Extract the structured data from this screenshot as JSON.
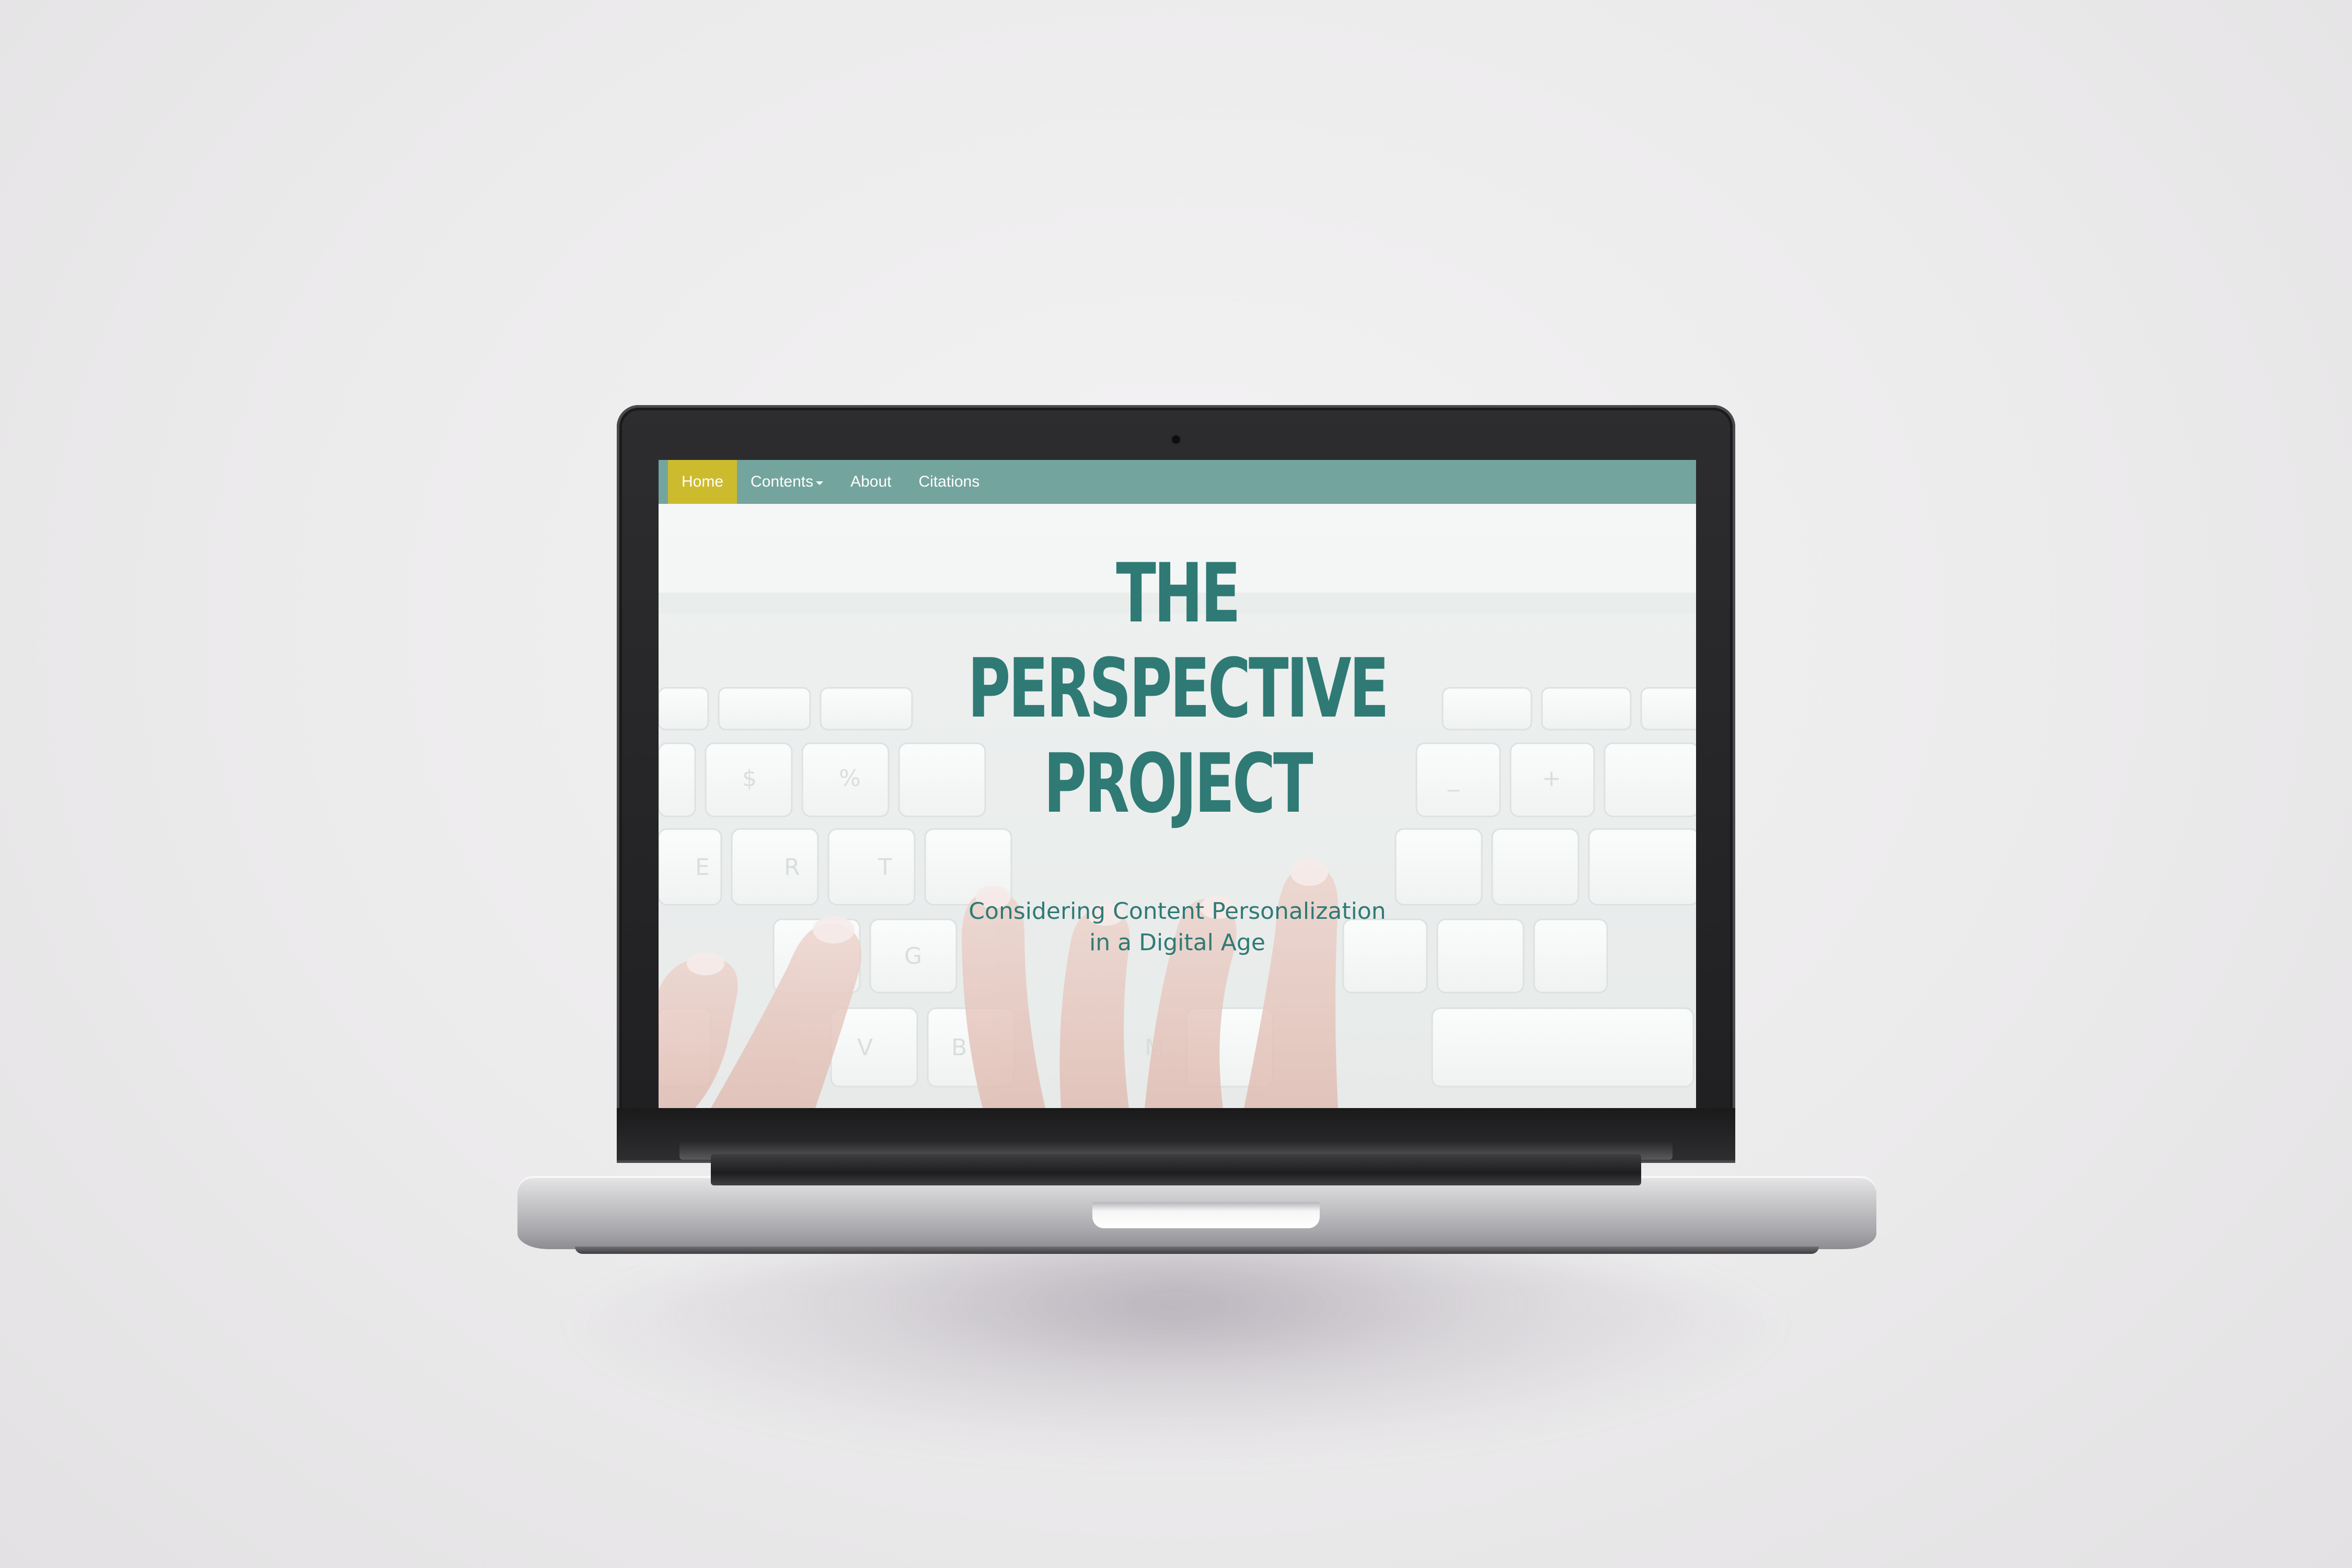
{
  "navbar": {
    "items": [
      {
        "label": "Home",
        "active": true
      },
      {
        "label": "Contents",
        "has_dropdown": true
      },
      {
        "label": "About"
      },
      {
        "label": "Citations"
      }
    ]
  },
  "hero": {
    "title_lines": [
      "THE",
      "PERSPECTIVE",
      "PROJECT"
    ],
    "subtitle_lines": [
      "Considering Content Personalization",
      "in a Digital Age"
    ]
  },
  "colors": {
    "navbar": "#74a49e",
    "nav_active": "#cdbb2e",
    "title": "#2f7a75",
    "page_background": "#eceaec"
  },
  "icons": {
    "dropdown": "caret-down-icon",
    "camera": "webcam"
  }
}
